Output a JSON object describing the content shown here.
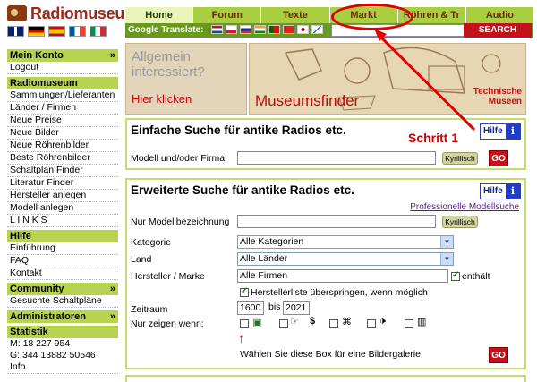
{
  "brand": {
    "name": "Radiomuseum"
  },
  "nav": {
    "tabs": [
      {
        "label": "Home",
        "active": true
      },
      {
        "label": "Forum",
        "active": false
      },
      {
        "label": "Texte",
        "active": false
      },
      {
        "label": "Markt",
        "active": false
      },
      {
        "label": "Röhren & Tr",
        "active": false
      },
      {
        "label": "Audio",
        "active": false
      }
    ]
  },
  "translate": {
    "label": "Google Translate:",
    "search_button": "SEARCH"
  },
  "sidebar": {
    "mein_konto": "Mein Konto",
    "logout": "Logout",
    "radiomuseum": "Radiomuseum",
    "items": [
      "Sammlungen/Lieferanten",
      "Länder / Firmen",
      "Neue Preise",
      "Neue Bilder",
      "Neue Röhrenbilder",
      "Beste Röhrenbilder",
      "Schaltplan Finder",
      "Literatur Finder",
      "Hersteller anlegen",
      "Modell anlegen",
      "L I N K S"
    ],
    "hilfe": "Hilfe",
    "hilfe_items": [
      "Einführung",
      "FAQ",
      "Kontakt"
    ],
    "community": "Community",
    "community_items": [
      "Gesuchte Schaltpläne"
    ],
    "administratoren": "Administratoren",
    "statistik": "Statistik",
    "stats_m": "M:  18  227  954",
    "stats_g": "G:  344   13882   50546",
    "info": "Info"
  },
  "banner": {
    "question": "Allgemein interessiert?",
    "click": "Hier klicken",
    "finder": "Museumsfinder",
    "technische": "Technische",
    "museen": "Museen"
  },
  "simple_search": {
    "title": "Einfache Suche für antike Radios etc.",
    "hilfe": "Hilfe",
    "info_glyph": "i",
    "field_label": "Modell und/oder Firma",
    "kyrillisch": "Kyrillisch",
    "go": "GO"
  },
  "advanced_search": {
    "title": "Erweiterte Suche für antike Radios etc.",
    "hilfe": "Hilfe",
    "info_glyph": "i",
    "pro_link": "Professionelle Modellsuche",
    "model_label": "Nur Modellbezeichnung",
    "kyrillisch": "Kyrillisch",
    "category_label": "Kategorie",
    "category_value": "Alle Kategorien",
    "land_label": "Land",
    "land_value": "Alle Länder",
    "manufacturer_label": "Hersteller / Marke",
    "manufacturer_value": "Alle Firmen",
    "enthalt": "enthält",
    "skip_list": "Herstellerliste überspringen, wenn möglich",
    "zeitraum_label": "Zeitraum",
    "year_from": "1600",
    "bis": "bis",
    "year_to": "2021",
    "nur_zeigen": "Nur zeigen wenn:",
    "dollar": "$",
    "gallery_hint": "Wählen Sie diese Box für eine Bildergalerie.",
    "go": "GO"
  },
  "annotation": {
    "schritt": "Schritt 1"
  },
  "colors": {
    "accent": "#a9cf41",
    "brand": "#a0281a",
    "alert": "#d60000"
  }
}
